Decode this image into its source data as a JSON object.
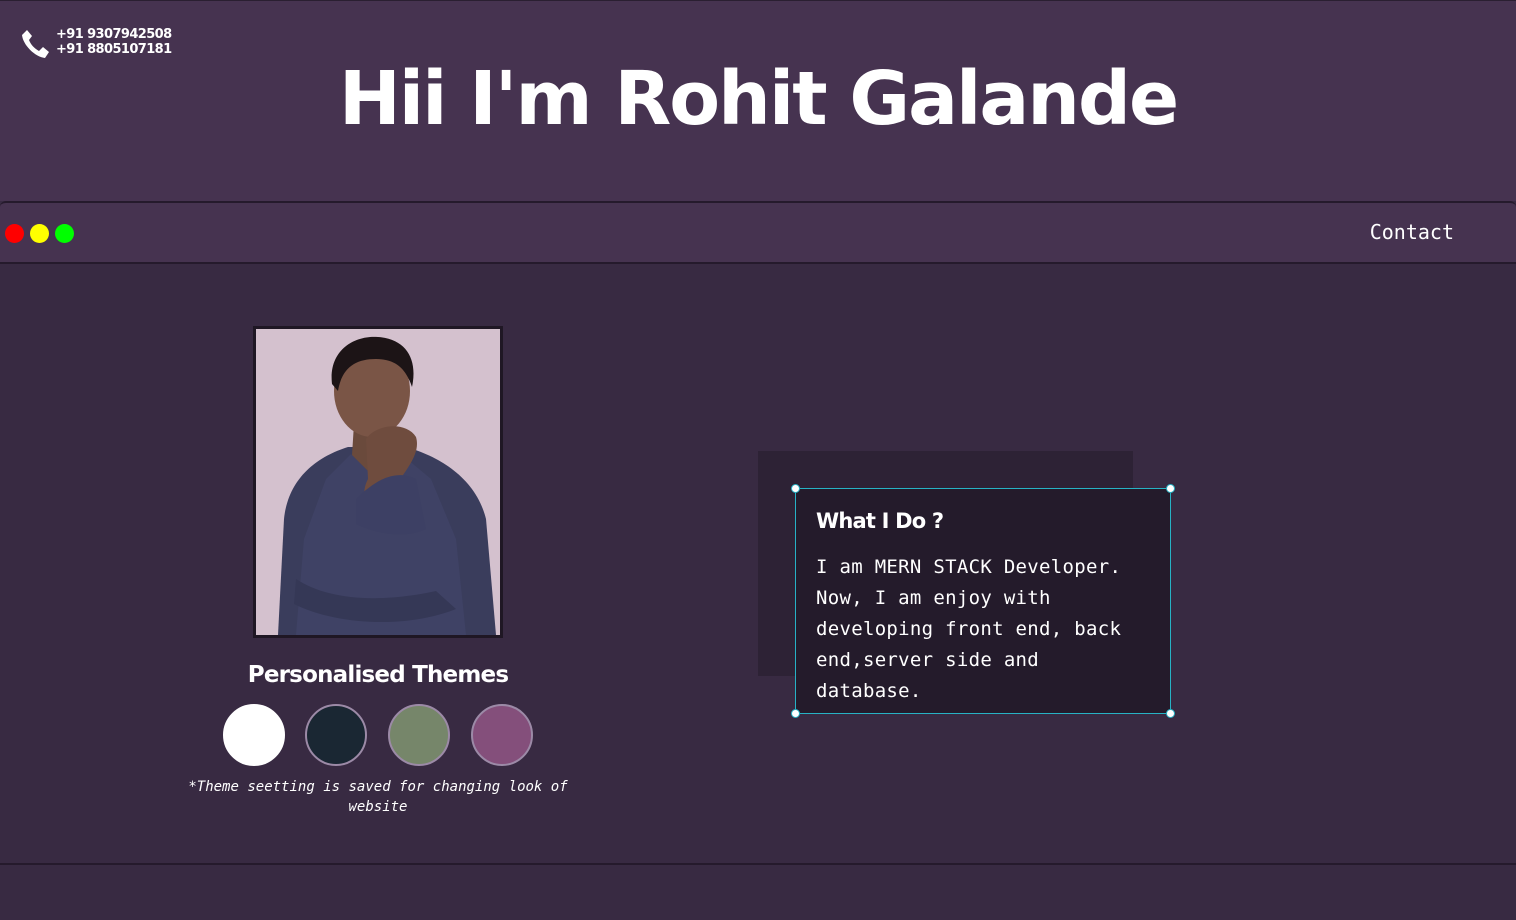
{
  "header": {
    "phones": [
      "+91 9307942508",
      "+91 8805107181"
    ],
    "title": "Hii I'm Rohit Galande"
  },
  "window_bar": {
    "dots": [
      "red",
      "yellow",
      "green"
    ],
    "nav": {
      "contact_label": "Contact"
    }
  },
  "profile": {
    "photo_alt": "Rohit Galande"
  },
  "themes": {
    "title": "Personalised Themes",
    "swatches": [
      "#ffffff",
      "#1a2733",
      "#76866a",
      "#844f7b"
    ],
    "note": "*Theme seetting is saved for changing look of website"
  },
  "what_i_do": {
    "title": "What I Do ?",
    "text": "I am MERN STACK Developer. Now, I am enjoy with developing front end, back end,server side and database."
  },
  "colors": {
    "header_bg": "#463350",
    "page_bg": "#382a42",
    "card_bg": "#241b2b",
    "card_border": "#27b2c4"
  }
}
